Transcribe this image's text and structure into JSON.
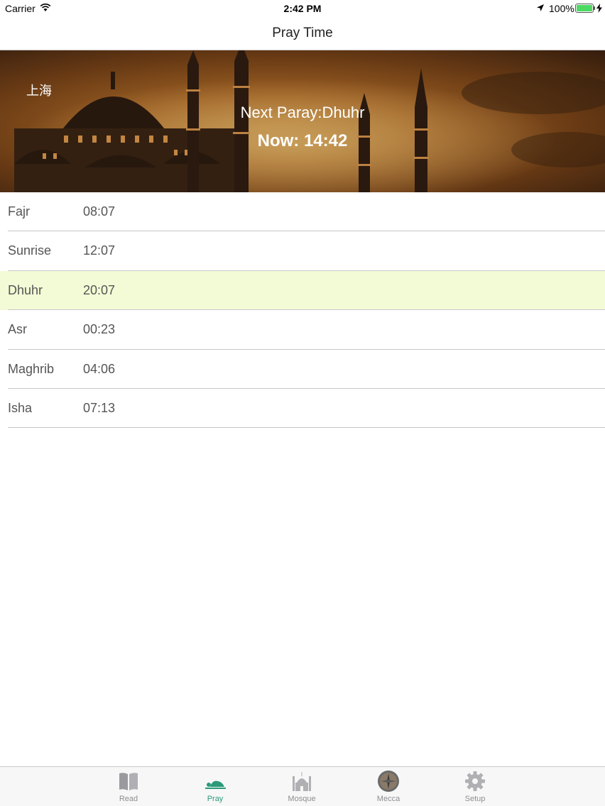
{
  "status_bar": {
    "carrier": "Carrier",
    "time": "2:42 PM",
    "battery": "100%"
  },
  "nav": {
    "title": "Pray Time"
  },
  "banner": {
    "city": "上海",
    "next_prayer": "Next Paray:Dhuhr",
    "now": "Now: 14:42"
  },
  "prayers": [
    {
      "name": "Fajr",
      "time": "08:07"
    },
    {
      "name": "Sunrise",
      "time": "12:07"
    },
    {
      "name": "Dhuhr",
      "time": "20:07"
    },
    {
      "name": "Asr",
      "time": "00:23"
    },
    {
      "name": "Maghrib",
      "time": "04:06"
    },
    {
      "name": "Isha",
      "time": "07:13"
    }
  ],
  "highlighted_prayer": "Dhuhr",
  "tabs": [
    {
      "label": "Read",
      "icon": "book-icon",
      "selected": false
    },
    {
      "label": "Pray",
      "icon": "pray-icon",
      "selected": true
    },
    {
      "label": "Mosque",
      "icon": "mosque-icon",
      "selected": false
    },
    {
      "label": "Mecca",
      "icon": "compass-icon",
      "selected": false
    },
    {
      "label": "Setup",
      "icon": "gear-icon",
      "selected": false
    }
  ],
  "colors": {
    "accent": "#2a9a78",
    "highlight_row": "#f3fbd6",
    "battery": "#4cd964"
  }
}
